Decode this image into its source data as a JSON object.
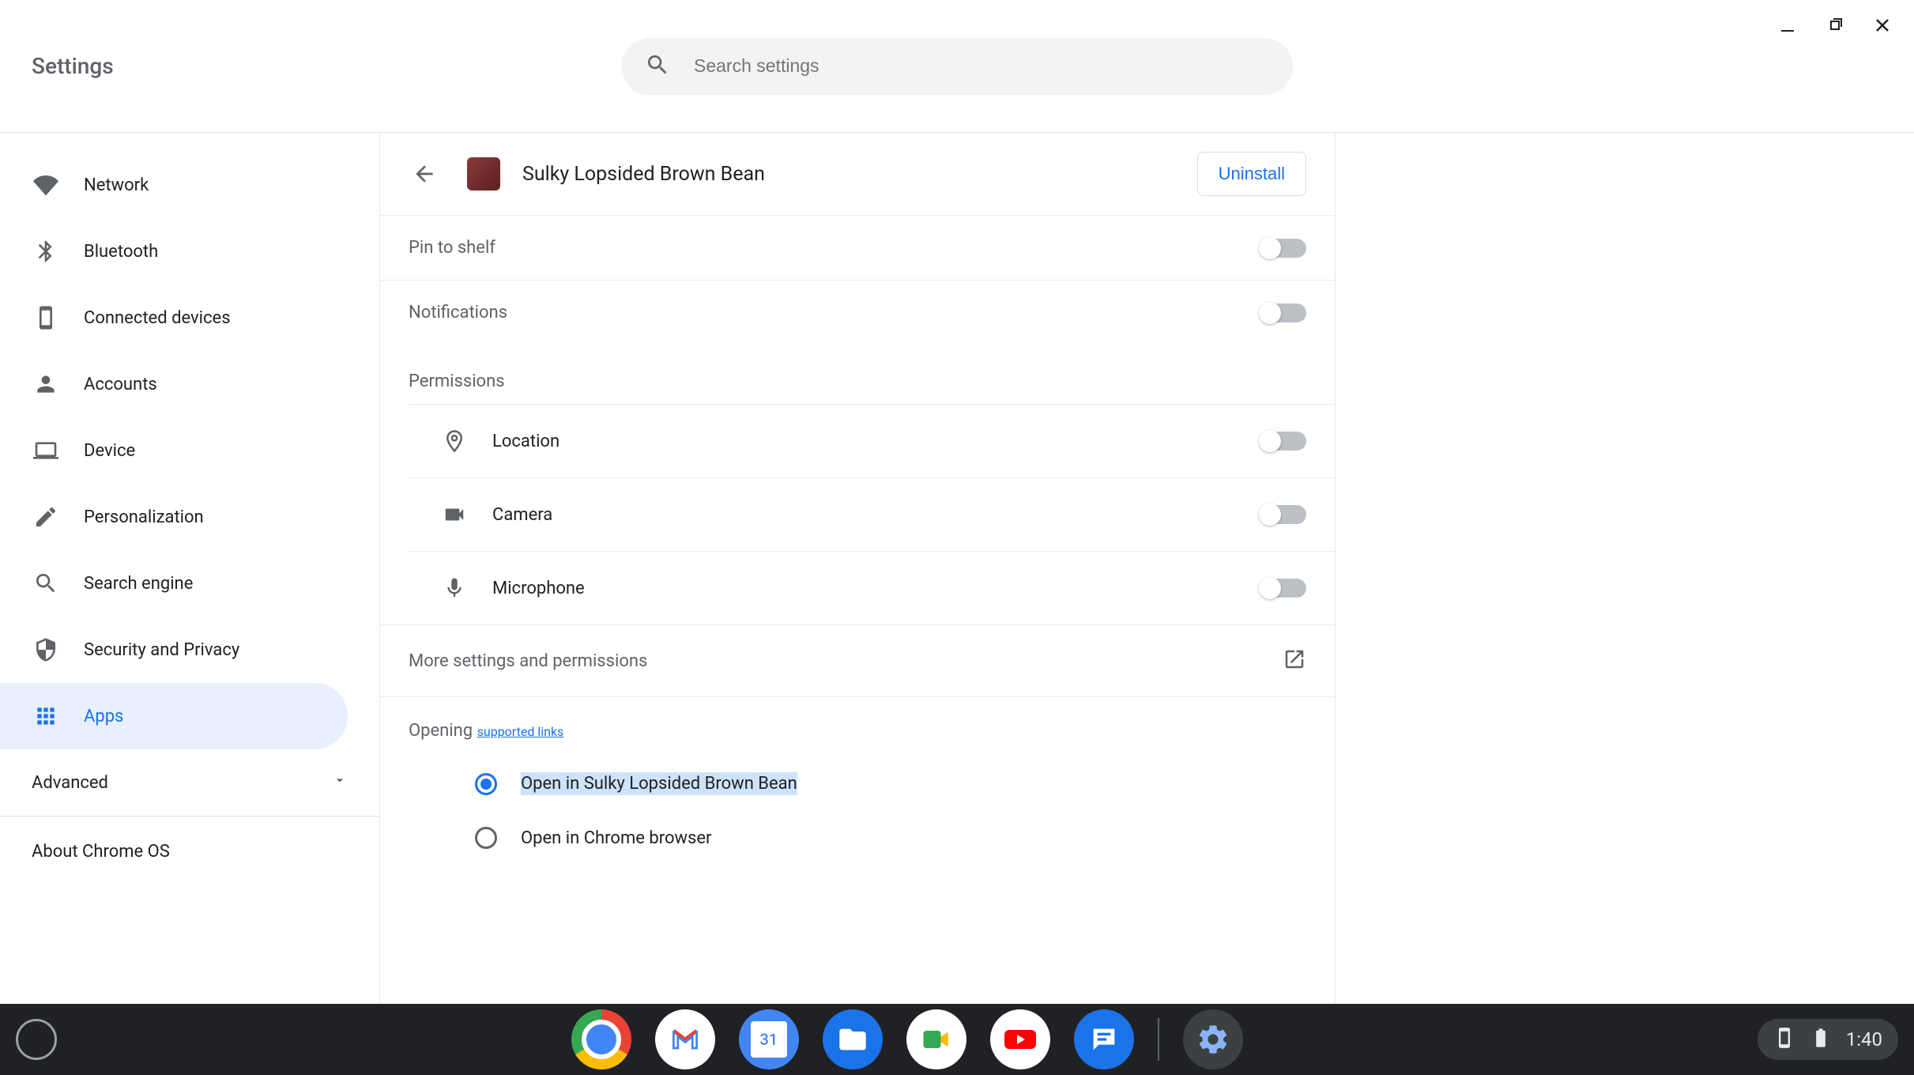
{
  "header": {
    "title": "Settings",
    "search_placeholder": "Search settings"
  },
  "sidebar": {
    "items": [
      {
        "label": "Network",
        "icon": "wifi"
      },
      {
        "label": "Bluetooth",
        "icon": "bluetooth"
      },
      {
        "label": "Connected devices",
        "icon": "phone"
      },
      {
        "label": "Accounts",
        "icon": "person"
      },
      {
        "label": "Device",
        "icon": "laptop"
      },
      {
        "label": "Personalization",
        "icon": "edit"
      },
      {
        "label": "Search engine",
        "icon": "search"
      },
      {
        "label": "Security and Privacy",
        "icon": "shield"
      },
      {
        "label": "Apps",
        "icon": "apps",
        "active": true
      }
    ],
    "advanced": "Advanced",
    "about": "About Chrome OS"
  },
  "detail": {
    "app_name": "Sulky Lopsided Brown Bean",
    "uninstall": "Uninstall",
    "pin_to_shelf": "Pin to shelf",
    "notifications": "Notifications",
    "permissions_head": "Permissions",
    "perm_location": "Location",
    "perm_camera": "Camera",
    "perm_microphone": "Microphone",
    "more_settings": "More settings and permissions",
    "opening_prefix": "Opening ",
    "opening_link": "supported links",
    "radio_open_app": "Open in Sulky Lopsided Brown Bean",
    "radio_open_chrome": "Open in Chrome browser"
  },
  "shelf": {
    "time": "1:40"
  }
}
